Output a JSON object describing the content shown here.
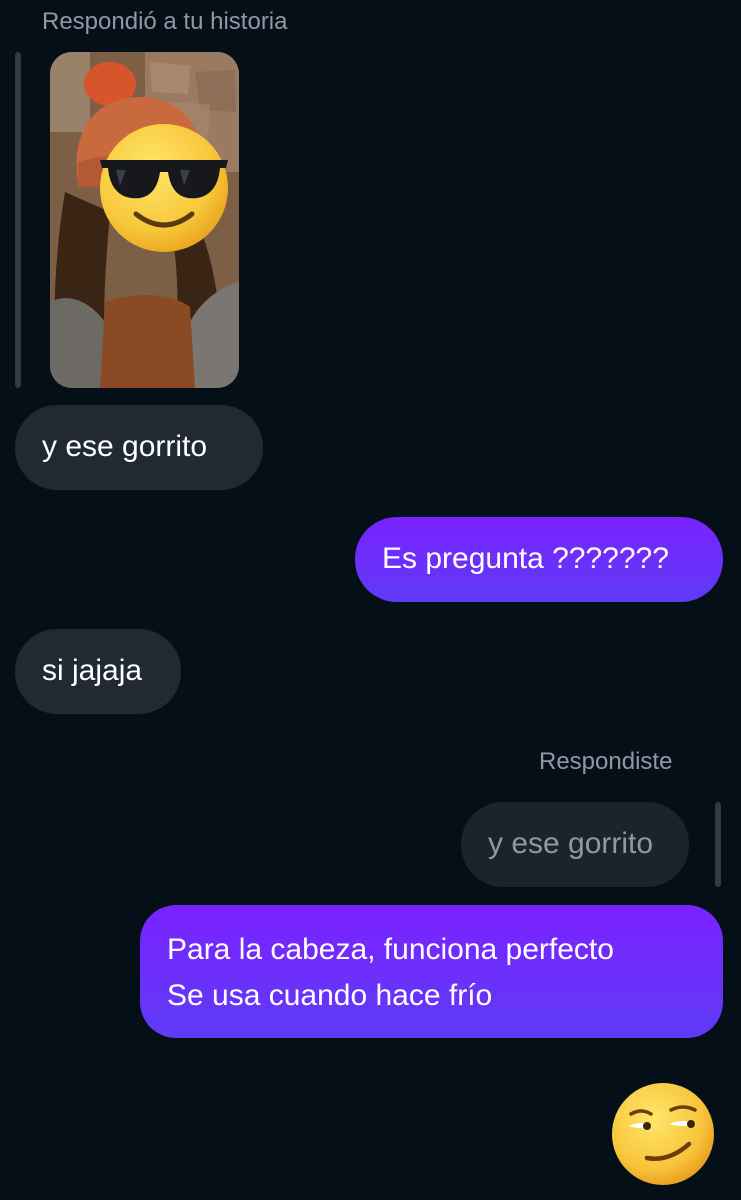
{
  "conversation": {
    "story_reply_label": "Respondió a tu historia",
    "message_1": "y ese gorrito",
    "message_2": "Es pregunta ???????",
    "message_3": "si jajaja",
    "reply_label": "Respondiste",
    "quoted_message": "y ese gorrito",
    "message_4_line_1": "Para la cabeza, funciona perfecto",
    "message_4_line_2": "Se usa cuando hace frío",
    "emoji_reaction": "smirking-face"
  },
  "colors": {
    "background": "#050f17",
    "incoming_bubble": "#212a33",
    "outgoing_bubble": "#6c2bff",
    "meta_text": "#8e99a6"
  }
}
